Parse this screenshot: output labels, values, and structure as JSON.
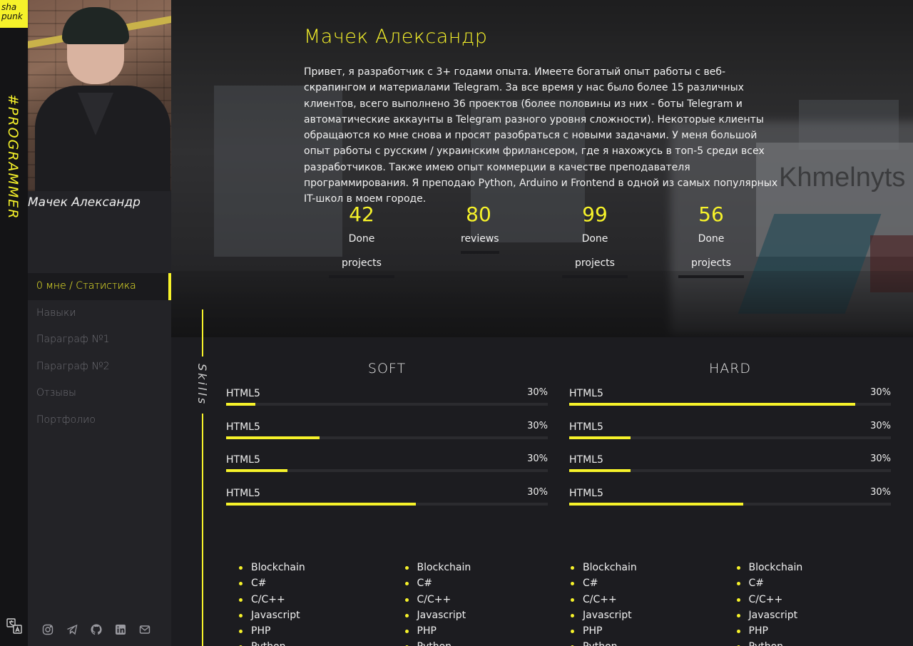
{
  "brand": {
    "logo_line1": "sha",
    "logo_line2": "punk",
    "vertical_tag": "#PROGRAMMER"
  },
  "sidebar": {
    "name": "Мачек Александр",
    "nav": [
      {
        "label": "0 мне / Статистика",
        "active": true
      },
      {
        "label": "Навыки"
      },
      {
        "label": "Параграф №1"
      },
      {
        "label": "Параграф №2"
      },
      {
        "label": "Отзывы"
      },
      {
        "label": "Портфолио"
      }
    ],
    "socials": [
      "instagram-icon",
      "telegram-icon",
      "github-icon",
      "linkedin-icon",
      "mail-icon"
    ]
  },
  "hero": {
    "title": "Мачек Александр",
    "intro": "Привет, я разработчик с 3+ годами опыта. Имеете богатый опыт работы с веб-скрапингом и материалами Telegram. За все время у нас было более 15 различных клиентов, всего выполнено 36 проектов (более половины из них - боты Telegram и автоматические аккаунты в Telegram разного уровня сложности). Некоторые клиенты обращаются ко мне снова и просят разобраться с новыми задачами. У меня большой опыт работы с русским / украинским фрилансером, где я нахожусь в топ-5 среди всех разработчиков. Также имею опыт коммерции в качестве преподавателя программирования. Я преподаю Python, Arduino и Frontend в одной из самых популярных IT-школ в моем городе.",
    "banner_text": "Khmelnyts",
    "stats": [
      {
        "value": "42",
        "label": "Done projects"
      },
      {
        "value": "80",
        "label": "reviews"
      },
      {
        "value": "99",
        "label": "Done projects"
      },
      {
        "value": "56",
        "label": "Done projects"
      }
    ]
  },
  "skills": {
    "section_label": "Skills",
    "soft": {
      "title": "SOFT",
      "items": [
        {
          "name": "HTML5",
          "percent_label": "30%",
          "fill": 0.09
        },
        {
          "name": "HTML5",
          "percent_label": "30%",
          "fill": 0.29
        },
        {
          "name": "HTML5",
          "percent_label": "30%",
          "fill": 0.19
        },
        {
          "name": "HTML5",
          "percent_label": "30%",
          "fill": 0.59
        }
      ]
    },
    "hard": {
      "title": "HARD",
      "items": [
        {
          "name": "HTML5",
          "percent_label": "30%",
          "fill": 0.89
        },
        {
          "name": "HTML5",
          "percent_label": "30%",
          "fill": 0.19
        },
        {
          "name": "HTML5",
          "percent_label": "30%",
          "fill": 0.19
        },
        {
          "name": "HTML5",
          "percent_label": "30%",
          "fill": 0.54
        }
      ]
    },
    "lists": [
      [
        "Blockchain",
        "C#",
        "C/C++",
        "Javascript",
        "PHP",
        "Python"
      ],
      [
        "Blockchain",
        "C#",
        "C/C++",
        "Javascript",
        "PHP",
        "Python"
      ],
      [
        "Blockchain",
        "C#",
        "C/C++",
        "Javascript",
        "PHP",
        "Python"
      ],
      [
        "Blockchain",
        "C#",
        "C/C++",
        "Javascript",
        "PHP",
        "Python"
      ]
    ]
  },
  "colors": {
    "accent": "#f6f22a",
    "background": "#1c1c20",
    "sidebar": "#232327"
  }
}
